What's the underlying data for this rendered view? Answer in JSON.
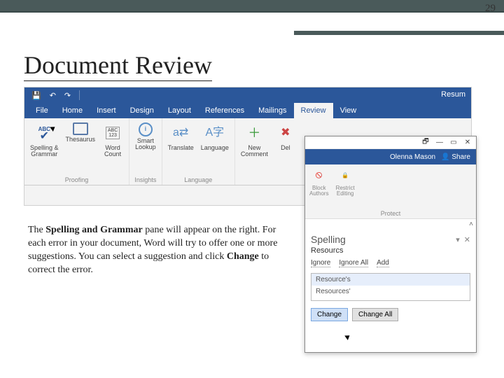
{
  "page_number": "29",
  "title": "Document Review",
  "qat": {
    "doc_title": "Resum"
  },
  "tabs": {
    "file": "File",
    "home": "Home",
    "insert": "Insert",
    "design": "Design",
    "layout": "Layout",
    "references": "References",
    "mailings": "Mailings",
    "review": "Review",
    "view": "View"
  },
  "ribbon": {
    "proofing": {
      "label": "Proofing",
      "spelling": "Spelling &\nGrammar",
      "thesaurus": "Thesaurus",
      "wordcount": "Word\nCount",
      "abc": "ABC",
      "abc123": "ABC\n123"
    },
    "insights": {
      "label": "Insights",
      "smartlookup": "Smart\nLookup"
    },
    "language": {
      "label": "Language",
      "translate": "Translate",
      "language": "Language"
    },
    "comments": {
      "newcomment": "New\nComment",
      "delete": "Del"
    }
  },
  "body": {
    "pre": "The ",
    "bold1": "Spelling and Grammar",
    "mid1": " pane will appear on the right. For each error in your document, Word will try to offer one or more suggestions. You can select a suggestion and click ",
    "bold2": "Change",
    "post": " to correct the error."
  },
  "pane": {
    "user": "Olenna Mason",
    "share": "Share",
    "protect_label": "Protect",
    "block": "Block\nAuthors",
    "restrict": "Restrict\nEditing",
    "spelling_title": "Spelling",
    "word": "Resourcs",
    "ignore": "Ignore",
    "ignore_all": "Ignore All",
    "add": "Add",
    "suggestion1": "Resource's",
    "suggestion2": "Resources'",
    "change": "Change",
    "change_all": "Change All"
  }
}
